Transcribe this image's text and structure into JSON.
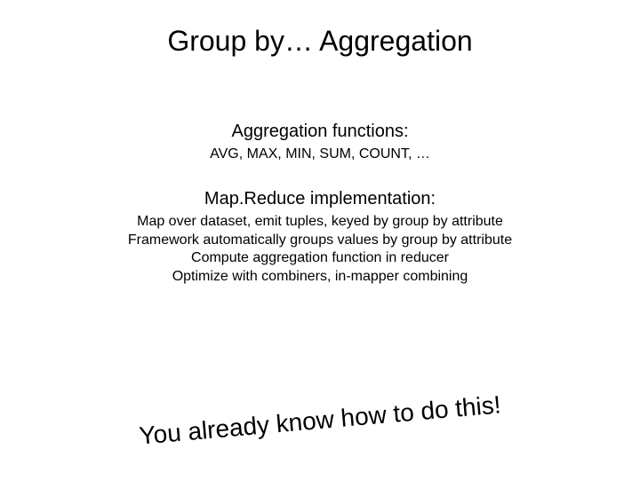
{
  "title": "Group by… Aggregation",
  "section1": {
    "heading": "Aggregation functions:",
    "body": "AVG, MAX, MIN, SUM, COUNT, …"
  },
  "section2": {
    "heading": "Map.Reduce implementation:",
    "lines": {
      "l1": "Map over dataset, emit tuples, keyed by group by attribute",
      "l2": "Framework automatically groups values by group by attribute",
      "l3": "Compute aggregation function in reducer",
      "l4": "Optimize with combiners, in-mapper combining"
    }
  },
  "callout": "You already know how to do this!"
}
